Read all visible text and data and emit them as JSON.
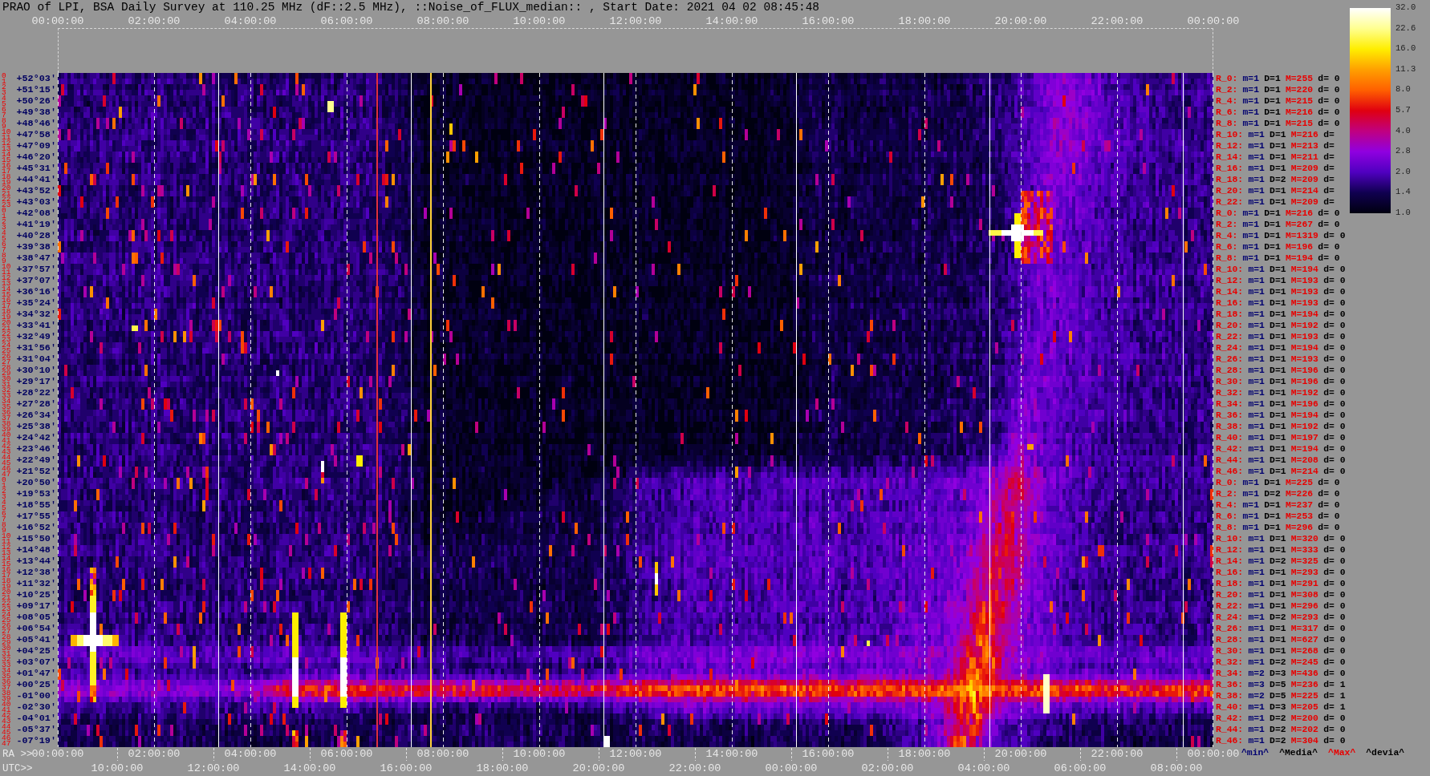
{
  "title": "PRAO of LPI, BSA Daily Survey at 110.25 MHz (dF::2.5 MHz), ::Noise_of_FLUX_median:: , Start Date: 2021 04 02 08:45:48",
  "top_axis": {
    "labels": [
      "00:00:00",
      "02:00:00",
      "04:00:00",
      "06:00:00",
      "08:00:00",
      "10:00:00",
      "12:00:00",
      "14:00:00",
      "16:00:00",
      "18:00:00",
      "20:00:00",
      "22:00:00",
      "00:00:00"
    ]
  },
  "rows": [
    {
      "index_labels": [
        "0",
        "1"
      ],
      "declination": "+52°03′",
      "stats": [
        "R_0:",
        "m=1",
        "D=1",
        "M=255",
        "d= 0"
      ]
    },
    {
      "index_labels": [
        "2",
        "3"
      ],
      "declination": "+51°15′",
      "stats": [
        "R_2:",
        "m=1",
        "D=1",
        "M=220",
        "d= 0"
      ]
    },
    {
      "index_labels": [
        "4",
        "5"
      ],
      "declination": "+50°26′",
      "stats": [
        "R_4:",
        "m=1",
        "D=1",
        "M=215",
        "d= 0"
      ]
    },
    {
      "index_labels": [
        "6",
        "7"
      ],
      "declination": "+49°38′",
      "stats": [
        "R_6:",
        "m=1",
        "D=1",
        "M=216",
        "d= 0"
      ]
    },
    {
      "index_labels": [
        "8",
        "9"
      ],
      "declination": "+48°46′",
      "stats": [
        "R_8:",
        "m=1",
        "D=1",
        "M=215",
        "d= 0"
      ]
    },
    {
      "index_labels": [
        "10",
        "11"
      ],
      "declination": "+47°58′",
      "stats": [
        "R_10:",
        "m=1",
        "D=1",
        "M=216",
        "d="
      ]
    },
    {
      "index_labels": [
        "12",
        "13"
      ],
      "declination": "+47°09′",
      "stats": [
        "R_12:",
        "m=1",
        "D=1",
        "M=213",
        "d="
      ]
    },
    {
      "index_labels": [
        "14",
        "15"
      ],
      "declination": "+46°20′",
      "stats": [
        "R_14:",
        "m=1",
        "D=1",
        "M=211",
        "d="
      ]
    },
    {
      "index_labels": [
        "16",
        "17"
      ],
      "declination": "+45°31′",
      "stats": [
        "R_16:",
        "m=1",
        "D=1",
        "M=209",
        "d="
      ]
    },
    {
      "index_labels": [
        "18",
        "19"
      ],
      "declination": "+44°41′",
      "stats": [
        "R_18:",
        "m=1",
        "D=2",
        "M=209",
        "d="
      ]
    },
    {
      "index_labels": [
        "20",
        "21"
      ],
      "declination": "+43°52′",
      "stats": [
        "R_20:",
        "m=1",
        "D=1",
        "M=214",
        "d="
      ]
    },
    {
      "index_labels": [
        "22",
        "23"
      ],
      "declination": "+43°03′",
      "stats": [
        "R_22:",
        "m=1",
        "D=1",
        "M=209",
        "d="
      ]
    },
    {
      "index_labels": [
        "0",
        "1"
      ],
      "declination": "+42°08′",
      "stats": [
        "R_0:",
        "m=1",
        "D=1",
        "M=216",
        "d= 0"
      ]
    },
    {
      "index_labels": [
        "2",
        "3"
      ],
      "declination": "+41°19′",
      "stats": [
        "R_2:",
        "m=1",
        "D=1",
        "M=267",
        "d= 0"
      ]
    },
    {
      "index_labels": [
        "4",
        "5"
      ],
      "declination": "+40°28′",
      "stats": [
        "R_4:",
        "m=1",
        "D=1",
        "M=1319",
        "d= 0"
      ]
    },
    {
      "index_labels": [
        "6",
        "7"
      ],
      "declination": "+39°38′",
      "stats": [
        "R_6:",
        "m=1",
        "D=1",
        "M=196",
        "d= 0"
      ]
    },
    {
      "index_labels": [
        "8",
        "9"
      ],
      "declination": "+38°47′",
      "stats": [
        "R_8:",
        "m=1",
        "D=1",
        "M=194",
        "d= 0"
      ]
    },
    {
      "index_labels": [
        "10",
        "11"
      ],
      "declination": "+37°57′",
      "stats": [
        "R_10:",
        "m=1",
        "D=1",
        "M=194",
        "d= 0"
      ]
    },
    {
      "index_labels": [
        "12",
        "13"
      ],
      "declination": "+37°07′",
      "stats": [
        "R_12:",
        "m=1",
        "D=1",
        "M=193",
        "d= 0"
      ]
    },
    {
      "index_labels": [
        "14",
        "15"
      ],
      "declination": "+36°16′",
      "stats": [
        "R_14:",
        "m=1",
        "D=1",
        "M=193",
        "d= 0"
      ]
    },
    {
      "index_labels": [
        "16",
        "17"
      ],
      "declination": "+35°24′",
      "stats": [
        "R_16:",
        "m=1",
        "D=1",
        "M=193",
        "d= 0"
      ]
    },
    {
      "index_labels": [
        "18",
        "19"
      ],
      "declination": "+34°32′",
      "stats": [
        "R_18:",
        "m=1",
        "D=1",
        "M=194",
        "d= 0"
      ]
    },
    {
      "index_labels": [
        "20",
        "21"
      ],
      "declination": "+33°41′",
      "stats": [
        "R_20:",
        "m=1",
        "D=1",
        "M=192",
        "d= 0"
      ]
    },
    {
      "index_labels": [
        "22",
        "23"
      ],
      "declination": "+32°49′",
      "stats": [
        "R_22:",
        "m=1",
        "D=1",
        "M=193",
        "d= 0"
      ]
    },
    {
      "index_labels": [
        "24",
        "25"
      ],
      "declination": "+31°56′",
      "stats": [
        "R_24:",
        "m=1",
        "D=1",
        "M=194",
        "d= 0"
      ]
    },
    {
      "index_labels": [
        "26",
        "27"
      ],
      "declination": "+31°04′",
      "stats": [
        "R_26:",
        "m=1",
        "D=1",
        "M=193",
        "d= 0"
      ]
    },
    {
      "index_labels": [
        "28",
        "29"
      ],
      "declination": "+30°10′",
      "stats": [
        "R_28:",
        "m=1",
        "D=1",
        "M=196",
        "d= 0"
      ]
    },
    {
      "index_labels": [
        "30",
        "31"
      ],
      "declination": "+29°17′",
      "stats": [
        "R_30:",
        "m=1",
        "D=1",
        "M=196",
        "d= 0"
      ]
    },
    {
      "index_labels": [
        "32",
        "33"
      ],
      "declination": "+28°22′",
      "stats": [
        "R_32:",
        "m=1",
        "D=1",
        "M=192",
        "d= 0"
      ]
    },
    {
      "index_labels": [
        "34",
        "35"
      ],
      "declination": "+27°28′",
      "stats": [
        "R_34:",
        "m=1",
        "D=1",
        "M=196",
        "d= 0"
      ]
    },
    {
      "index_labels": [
        "36",
        "37"
      ],
      "declination": "+26°34′",
      "stats": [
        "R_36:",
        "m=1",
        "D=1",
        "M=194",
        "d= 0"
      ]
    },
    {
      "index_labels": [
        "38",
        "39"
      ],
      "declination": "+25°38′",
      "stats": [
        "R_38:",
        "m=1",
        "D=1",
        "M=192",
        "d= 0"
      ]
    },
    {
      "index_labels": [
        "40",
        "41"
      ],
      "declination": "+24°42′",
      "stats": [
        "R_40:",
        "m=1",
        "D=1",
        "M=197",
        "d= 0"
      ]
    },
    {
      "index_labels": [
        "42",
        "43"
      ],
      "declination": "+23°46′",
      "stats": [
        "R_42:",
        "m=1",
        "D=1",
        "M=194",
        "d= 0"
      ]
    },
    {
      "index_labels": [
        "44",
        "45"
      ],
      "declination": "+22°49′",
      "stats": [
        "R_44:",
        "m=1",
        "D=1",
        "M=208",
        "d= 0"
      ]
    },
    {
      "index_labels": [
        "46",
        "47"
      ],
      "declination": "+21°52′",
      "stats": [
        "R_46:",
        "m=1",
        "D=1",
        "M=214",
        "d= 0"
      ]
    },
    {
      "index_labels": [
        "0",
        "1"
      ],
      "declination": "+20°50′",
      "stats": [
        "R_0:",
        "m=1",
        "D=1",
        "M=225",
        "d= 0"
      ]
    },
    {
      "index_labels": [
        "2",
        "3"
      ],
      "declination": "+19°53′",
      "stats": [
        "R_2:",
        "m=1",
        "D=2",
        "M=226",
        "d= 0"
      ]
    },
    {
      "index_labels": [
        "4",
        "5"
      ],
      "declination": "+18°55′",
      "stats": [
        "R_4:",
        "m=1",
        "D=1",
        "M=237",
        "d= 0"
      ]
    },
    {
      "index_labels": [
        "6",
        "7"
      ],
      "declination": "+17°55′",
      "stats": [
        "R_6:",
        "m=1",
        "D=1",
        "M=253",
        "d= 0"
      ]
    },
    {
      "index_labels": [
        "8",
        "9"
      ],
      "declination": "+16°52′",
      "stats": [
        "R_8:",
        "m=1",
        "D=1",
        "M=296",
        "d= 0"
      ]
    },
    {
      "index_labels": [
        "10",
        "11"
      ],
      "declination": "+15°50′",
      "stats": [
        "R_10:",
        "m=1",
        "D=1",
        "M=320",
        "d= 0"
      ]
    },
    {
      "index_labels": [
        "12",
        "13"
      ],
      "declination": "+14°48′",
      "stats": [
        "R_12:",
        "m=1",
        "D=1",
        "M=333",
        "d= 0"
      ]
    },
    {
      "index_labels": [
        "14",
        "15"
      ],
      "declination": "+13°44′",
      "stats": [
        "R_14:",
        "m=1",
        "D=2",
        "M=325",
        "d= 0"
      ]
    },
    {
      "index_labels": [
        "16",
        "17"
      ],
      "declination": "+12°38′",
      "stats": [
        "R_16:",
        "m=1",
        "D=1",
        "M=293",
        "d= 0"
      ]
    },
    {
      "index_labels": [
        "18",
        "19"
      ],
      "declination": "+11°32′",
      "stats": [
        "R_18:",
        "m=1",
        "D=1",
        "M=291",
        "d= 0"
      ]
    },
    {
      "index_labels": [
        "20",
        "21"
      ],
      "declination": "+10°25′",
      "stats": [
        "R_20:",
        "m=1",
        "D=1",
        "M=308",
        "d= 0"
      ]
    },
    {
      "index_labels": [
        "22",
        "23"
      ],
      "declination": "+09°17′",
      "stats": [
        "R_22:",
        "m=1",
        "D=1",
        "M=296",
        "d= 0"
      ]
    },
    {
      "index_labels": [
        "24",
        "25"
      ],
      "declination": "+08°05′",
      "stats": [
        "R_24:",
        "m=1",
        "D=2",
        "M=293",
        "d= 0"
      ]
    },
    {
      "index_labels": [
        "26",
        "27"
      ],
      "declination": "+06°54′",
      "stats": [
        "R_26:",
        "m=1",
        "D=1",
        "M=317",
        "d= 0"
      ]
    },
    {
      "index_labels": [
        "28",
        "29"
      ],
      "declination": "+05°41′",
      "stats": [
        "R_28:",
        "m=1",
        "D=1",
        "M=627",
        "d= 0"
      ]
    },
    {
      "index_labels": [
        "30",
        "31"
      ],
      "declination": "+04°25′",
      "stats": [
        "R_30:",
        "m=1",
        "D=1",
        "M=268",
        "d= 0"
      ]
    },
    {
      "index_labels": [
        "32",
        "33"
      ],
      "declination": "+03°07′",
      "stats": [
        "R_32:",
        "m=1",
        "D=2",
        "M=245",
        "d= 0"
      ]
    },
    {
      "index_labels": [
        "34",
        "35"
      ],
      "declination": "+01°47′",
      "stats": [
        "R_34:",
        "m=2",
        "D=3",
        "M=436",
        "d= 0"
      ]
    },
    {
      "index_labels": [
        "36",
        "37"
      ],
      "declination": "+00°25′",
      "stats": [
        "R_36:",
        "m=3",
        "D=5",
        "M=236",
        "d= 1"
      ]
    },
    {
      "index_labels": [
        "38",
        "39"
      ],
      "declination": "-01°00′",
      "stats": [
        "R_38:",
        "m=2",
        "D=5",
        "M=225",
        "d= 1"
      ]
    },
    {
      "index_labels": [
        "40",
        "41"
      ],
      "declination": "-02°30′",
      "stats": [
        "R_40:",
        "m=1",
        "D=3",
        "M=205",
        "d= 1"
      ]
    },
    {
      "index_labels": [
        "42",
        "43"
      ],
      "declination": "-04°01′",
      "stats": [
        "R_42:",
        "m=1",
        "D=2",
        "M=200",
        "d= 0"
      ]
    },
    {
      "index_labels": [
        "44",
        "45"
      ],
      "declination": "-05°37′",
      "stats": [
        "R_44:",
        "m=1",
        "D=2",
        "M=202",
        "d= 0"
      ]
    },
    {
      "index_labels": [
        "46",
        "47"
      ],
      "declination": "-07°19′",
      "stats": [
        "R_46:",
        "m=1",
        "D=2",
        "M=304",
        "d= 0"
      ]
    }
  ],
  "bottom_axis": {
    "ra_prefix": "RA >>",
    "ra_labels": [
      "00:00:00",
      "02:00:00",
      "04:00:00",
      "06:00:00",
      "08:00:00",
      "10:00:00",
      "12:00:00",
      "14:00:00",
      "16:00:00",
      "18:00:00",
      "20:00:00",
      "22:00:00",
      "00:00:00"
    ],
    "utc_prefix": "UTC>>",
    "utc_labels": [
      "10:00:00",
      "12:00:00",
      "14:00:00",
      "16:00:00",
      "18:00:00",
      "20:00:00",
      "22:00:00",
      "00:00:00",
      "02:00:00",
      "04:00:00",
      "06:00:00",
      "08:00:00"
    ]
  },
  "stats_legend": [
    "^min^",
    "^Media^",
    "^Max^",
    "^devia^"
  ],
  "colorbar": {
    "ticks": [
      "32.0",
      "22.6",
      "16.0",
      "11.3",
      "8.0",
      "5.7",
      "4.0",
      "2.8",
      "2.0",
      "1.4",
      "1.0"
    ]
  }
}
